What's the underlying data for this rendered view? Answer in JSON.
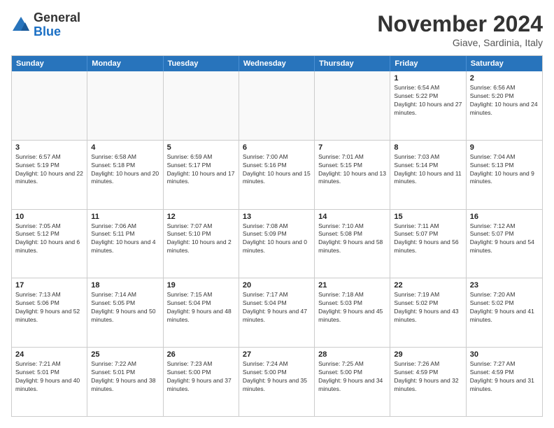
{
  "logo": {
    "general": "General",
    "blue": "Blue"
  },
  "title": "November 2024",
  "location": "Giave, Sardinia, Italy",
  "days_of_week": [
    "Sunday",
    "Monday",
    "Tuesday",
    "Wednesday",
    "Thursday",
    "Friday",
    "Saturday"
  ],
  "weeks": [
    [
      {
        "day": "",
        "info": "",
        "empty": true
      },
      {
        "day": "",
        "info": "",
        "empty": true
      },
      {
        "day": "",
        "info": "",
        "empty": true
      },
      {
        "day": "",
        "info": "",
        "empty": true
      },
      {
        "day": "",
        "info": "",
        "empty": true
      },
      {
        "day": "1",
        "info": "Sunrise: 6:54 AM\nSunset: 5:22 PM\nDaylight: 10 hours and 27 minutes.",
        "empty": false
      },
      {
        "day": "2",
        "info": "Sunrise: 6:56 AM\nSunset: 5:20 PM\nDaylight: 10 hours and 24 minutes.",
        "empty": false
      }
    ],
    [
      {
        "day": "3",
        "info": "Sunrise: 6:57 AM\nSunset: 5:19 PM\nDaylight: 10 hours and 22 minutes.",
        "empty": false
      },
      {
        "day": "4",
        "info": "Sunrise: 6:58 AM\nSunset: 5:18 PM\nDaylight: 10 hours and 20 minutes.",
        "empty": false
      },
      {
        "day": "5",
        "info": "Sunrise: 6:59 AM\nSunset: 5:17 PM\nDaylight: 10 hours and 17 minutes.",
        "empty": false
      },
      {
        "day": "6",
        "info": "Sunrise: 7:00 AM\nSunset: 5:16 PM\nDaylight: 10 hours and 15 minutes.",
        "empty": false
      },
      {
        "day": "7",
        "info": "Sunrise: 7:01 AM\nSunset: 5:15 PM\nDaylight: 10 hours and 13 minutes.",
        "empty": false
      },
      {
        "day": "8",
        "info": "Sunrise: 7:03 AM\nSunset: 5:14 PM\nDaylight: 10 hours and 11 minutes.",
        "empty": false
      },
      {
        "day": "9",
        "info": "Sunrise: 7:04 AM\nSunset: 5:13 PM\nDaylight: 10 hours and 9 minutes.",
        "empty": false
      }
    ],
    [
      {
        "day": "10",
        "info": "Sunrise: 7:05 AM\nSunset: 5:12 PM\nDaylight: 10 hours and 6 minutes.",
        "empty": false
      },
      {
        "day": "11",
        "info": "Sunrise: 7:06 AM\nSunset: 5:11 PM\nDaylight: 10 hours and 4 minutes.",
        "empty": false
      },
      {
        "day": "12",
        "info": "Sunrise: 7:07 AM\nSunset: 5:10 PM\nDaylight: 10 hours and 2 minutes.",
        "empty": false
      },
      {
        "day": "13",
        "info": "Sunrise: 7:08 AM\nSunset: 5:09 PM\nDaylight: 10 hours and 0 minutes.",
        "empty": false
      },
      {
        "day": "14",
        "info": "Sunrise: 7:10 AM\nSunset: 5:08 PM\nDaylight: 9 hours and 58 minutes.",
        "empty": false
      },
      {
        "day": "15",
        "info": "Sunrise: 7:11 AM\nSunset: 5:07 PM\nDaylight: 9 hours and 56 minutes.",
        "empty": false
      },
      {
        "day": "16",
        "info": "Sunrise: 7:12 AM\nSunset: 5:07 PM\nDaylight: 9 hours and 54 minutes.",
        "empty": false
      }
    ],
    [
      {
        "day": "17",
        "info": "Sunrise: 7:13 AM\nSunset: 5:06 PM\nDaylight: 9 hours and 52 minutes.",
        "empty": false
      },
      {
        "day": "18",
        "info": "Sunrise: 7:14 AM\nSunset: 5:05 PM\nDaylight: 9 hours and 50 minutes.",
        "empty": false
      },
      {
        "day": "19",
        "info": "Sunrise: 7:15 AM\nSunset: 5:04 PM\nDaylight: 9 hours and 48 minutes.",
        "empty": false
      },
      {
        "day": "20",
        "info": "Sunrise: 7:17 AM\nSunset: 5:04 PM\nDaylight: 9 hours and 47 minutes.",
        "empty": false
      },
      {
        "day": "21",
        "info": "Sunrise: 7:18 AM\nSunset: 5:03 PM\nDaylight: 9 hours and 45 minutes.",
        "empty": false
      },
      {
        "day": "22",
        "info": "Sunrise: 7:19 AM\nSunset: 5:02 PM\nDaylight: 9 hours and 43 minutes.",
        "empty": false
      },
      {
        "day": "23",
        "info": "Sunrise: 7:20 AM\nSunset: 5:02 PM\nDaylight: 9 hours and 41 minutes.",
        "empty": false
      }
    ],
    [
      {
        "day": "24",
        "info": "Sunrise: 7:21 AM\nSunset: 5:01 PM\nDaylight: 9 hours and 40 minutes.",
        "empty": false
      },
      {
        "day": "25",
        "info": "Sunrise: 7:22 AM\nSunset: 5:01 PM\nDaylight: 9 hours and 38 minutes.",
        "empty": false
      },
      {
        "day": "26",
        "info": "Sunrise: 7:23 AM\nSunset: 5:00 PM\nDaylight: 9 hours and 37 minutes.",
        "empty": false
      },
      {
        "day": "27",
        "info": "Sunrise: 7:24 AM\nSunset: 5:00 PM\nDaylight: 9 hours and 35 minutes.",
        "empty": false
      },
      {
        "day": "28",
        "info": "Sunrise: 7:25 AM\nSunset: 5:00 PM\nDaylight: 9 hours and 34 minutes.",
        "empty": false
      },
      {
        "day": "29",
        "info": "Sunrise: 7:26 AM\nSunset: 4:59 PM\nDaylight: 9 hours and 32 minutes.",
        "empty": false
      },
      {
        "day": "30",
        "info": "Sunrise: 7:27 AM\nSunset: 4:59 PM\nDaylight: 9 hours and 31 minutes.",
        "empty": false
      }
    ]
  ]
}
